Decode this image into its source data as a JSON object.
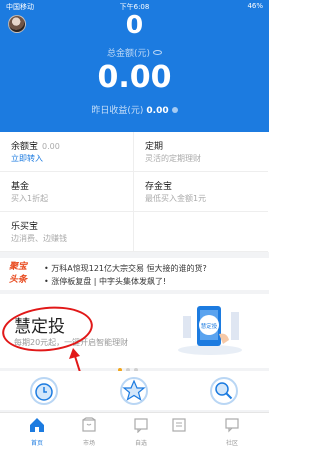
{
  "status_bar": {
    "carrier": "中国移动",
    "time": "下午6:08",
    "battery": "46%"
  },
  "header": {
    "count": "0",
    "total_label": "总金额(元)",
    "total_amount": "0.00",
    "yesterday_label": "昨日收益(元)",
    "yesterday_value": "0.00"
  },
  "products": [
    {
      "title": "余额宝",
      "value": "0.00",
      "sub": "立即转入"
    },
    {
      "title": "定期",
      "sub": "灵活的定期理财"
    },
    {
      "title": "基金",
      "sub": "买入1折起"
    },
    {
      "title": "存金宝",
      "sub": "最低买入金额1元"
    },
    {
      "title": "乐买宝",
      "sub": "边消费、边赚钱"
    }
  ],
  "news": {
    "logo_line1": "聚宝",
    "logo_line2": "头条",
    "items": [
      "• 万科A惊现121亿大宗交易 恒大接的谁的货?",
      "• 涨停板复盘 | 中字头集体发飙了!"
    ]
  },
  "banner": {
    "title": "慧定投",
    "subtitle": "每期20元起，一键开启智能理财",
    "badge": "慧定投"
  },
  "tabs": [
    {
      "label": "首页",
      "icon": "home-icon"
    },
    {
      "label": "市场",
      "icon": "market-icon"
    },
    {
      "label": "自选",
      "icon": "watchlist-icon"
    },
    {
      "label": "",
      "icon": "news-icon"
    },
    {
      "label": "社区",
      "icon": "community-icon"
    }
  ],
  "colors": {
    "accent": "#1c7be0",
    "highlight": "#e11818",
    "news_logo": "#e8491d"
  }
}
